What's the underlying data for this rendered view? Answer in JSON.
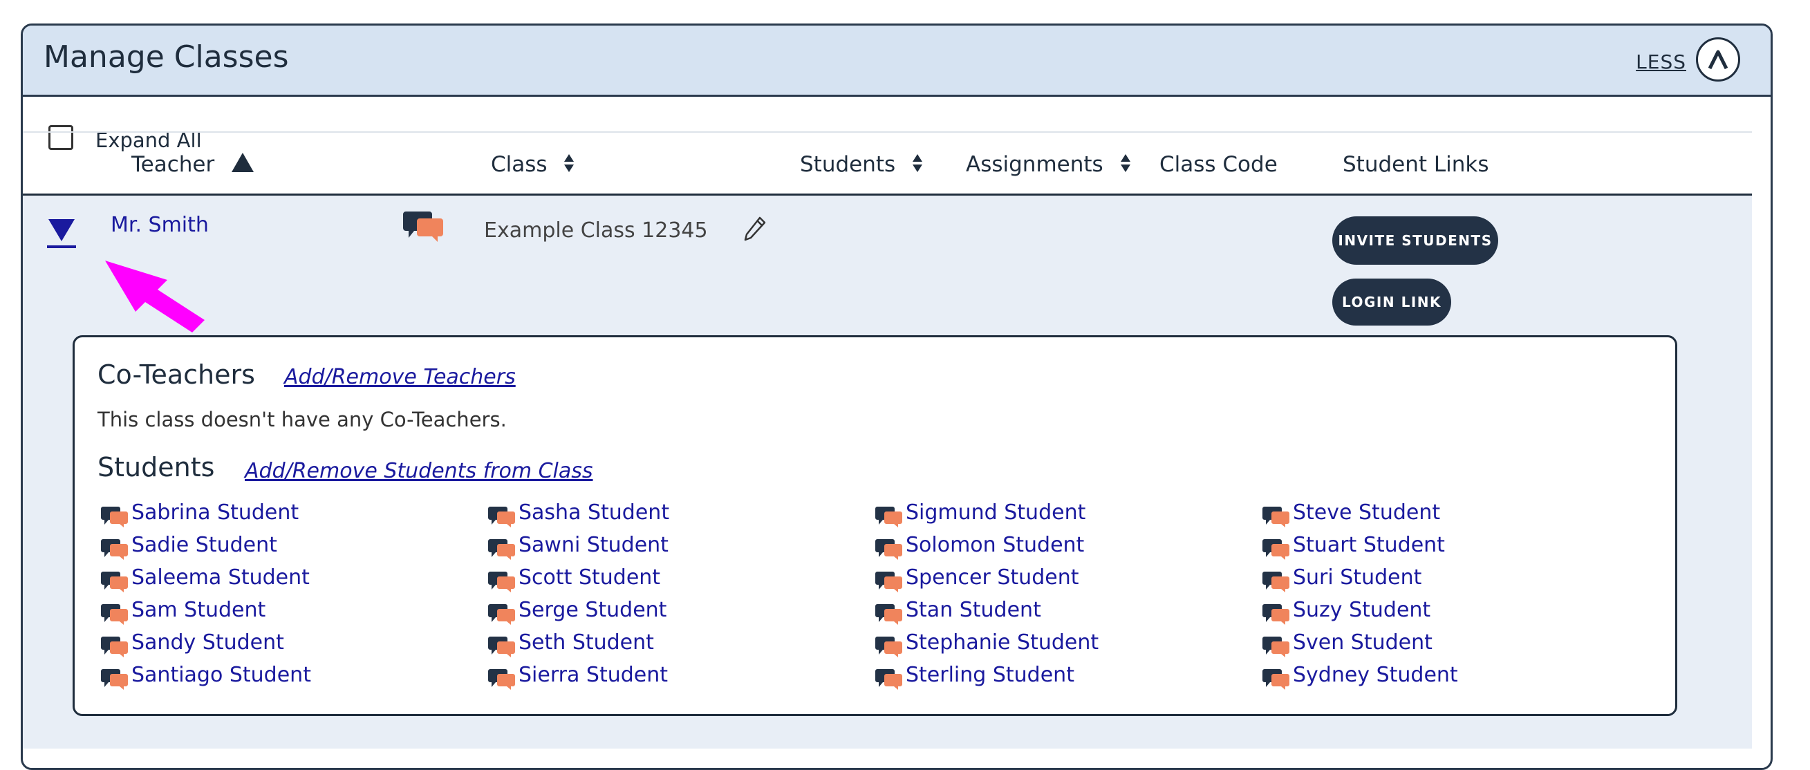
{
  "header": {
    "title": "Manage Classes",
    "less_label": "LESS"
  },
  "expand_all": {
    "label": "Expand All",
    "checked": false
  },
  "columns": {
    "teacher": "Teacher",
    "class": "Class",
    "students": "Students",
    "assignments": "Assignments",
    "class_code": "Class Code",
    "student_links": "Student Links"
  },
  "class_row": {
    "teacher": "Mr. Smith",
    "class_name": "Example Class 12345",
    "class_code": "",
    "invite_label": "INVITE STUDENTS",
    "login_label": "LOGIN LINK"
  },
  "co_teachers": {
    "title": "Co-Teachers",
    "link": "Add/Remove Teachers",
    "empty_text": "This class doesn't have any Co-Teachers."
  },
  "students": {
    "title": "Students",
    "link": "Add/Remove Students from Class",
    "columns": [
      [
        "Sabrina Student",
        "Sadie Student",
        "Saleema Student",
        "Sam Student",
        "Sandy Student",
        "Santiago Student"
      ],
      [
        "Sasha Student",
        "Sawni Student",
        "Scott Student",
        "Serge Student",
        "Seth Student",
        "Sierra Student"
      ],
      [
        "Sigmund Student",
        "Solomon Student",
        "Spencer Student",
        "Stan Student",
        "Stephanie Student",
        "Sterling Student"
      ],
      [
        "Steve Student",
        "Stuart Student",
        "Suri Student",
        "Suzy Student",
        "Sven Student",
        "Sydney Student"
      ]
    ]
  },
  "icons": {
    "expander": "triangle-down-icon",
    "chat": "chat-bubbles-icon",
    "edit": "pencil-icon",
    "collapse": "chevron-up-icon",
    "annotation": "magenta-arrow"
  },
  "colors": {
    "header_bg": "#d6e3f2",
    "row_bg": "#e8eef6",
    "link": "#1a1a9e",
    "pill_bg": "#233246",
    "chat_orange": "#f0845c",
    "arrow": "#ff00ff"
  }
}
